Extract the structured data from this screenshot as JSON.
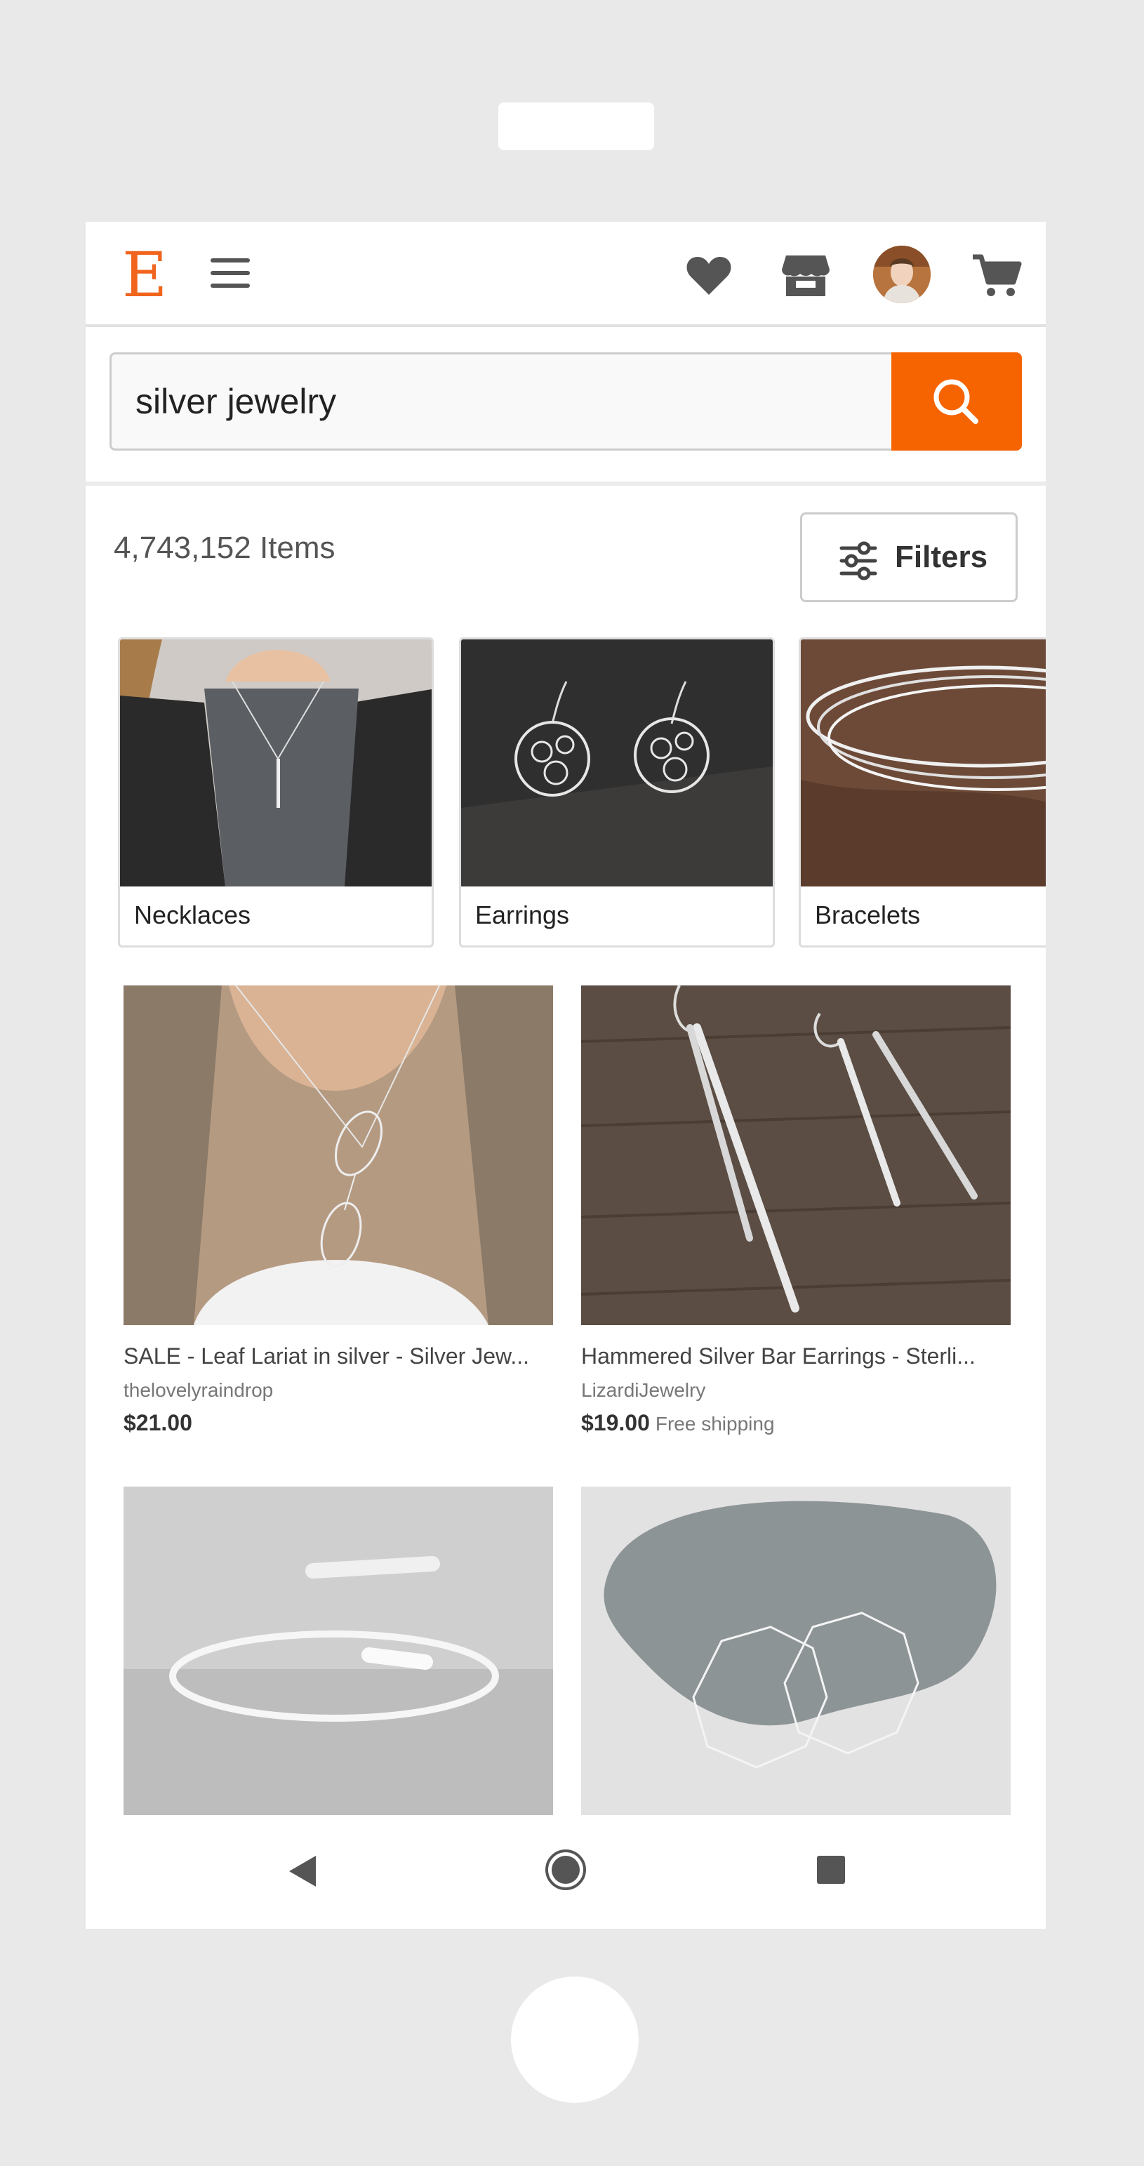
{
  "header": {
    "logo": "E",
    "menu_icon": "hamburger-menu-icon",
    "icons": [
      "heart-icon",
      "shop-icon",
      "avatar",
      "cart-icon"
    ],
    "accent_color": "#f56400"
  },
  "search": {
    "value": "silver jewelry",
    "placeholder": "Search for items or shops",
    "button_icon": "search-icon"
  },
  "results": {
    "count": "4,743,152 Items",
    "filters_label": "Filters",
    "filters_icon": "sliders-icon"
  },
  "categories": [
    {
      "label": "Necklaces"
    },
    {
      "label": "Earrings"
    },
    {
      "label": "Bracelets"
    }
  ],
  "listings": [
    {
      "title": "SALE - Leaf Lariat in silver - Silver Jew...",
      "shop": "thelovelyraindrop",
      "price": "$21.00",
      "shipping": ""
    },
    {
      "title": "Hammered Silver Bar Earrings - Sterli...",
      "shop": "LizardiJewelry",
      "price": "$19.00",
      "shipping": "Free shipping"
    },
    {
      "title": "",
      "shop": "",
      "price": "",
      "shipping": ""
    },
    {
      "title": "",
      "shop": "",
      "price": "",
      "shipping": ""
    }
  ],
  "navbar": {
    "icons": [
      "back-icon",
      "home-icon",
      "recents-icon"
    ]
  }
}
